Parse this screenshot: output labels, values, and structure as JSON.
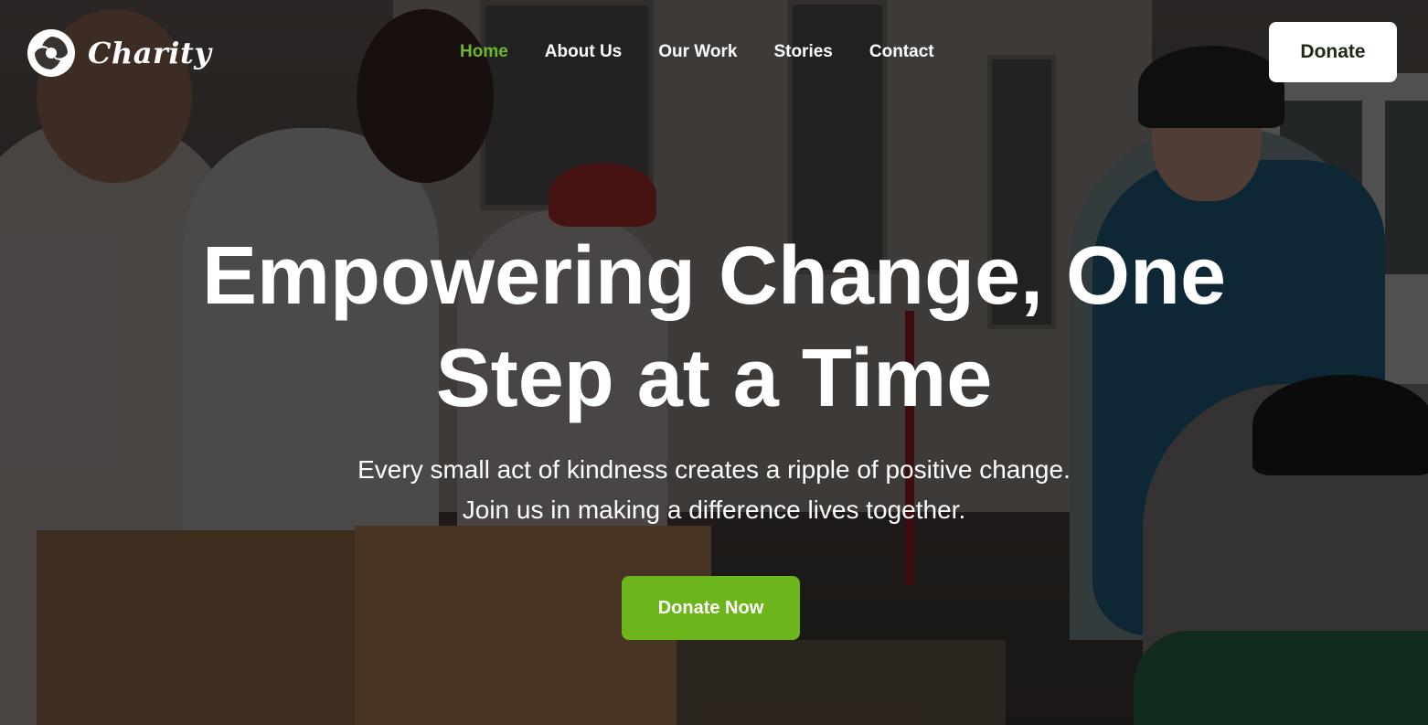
{
  "brand": {
    "name": "Charity",
    "logo_icon": "charity-swirl-logo-icon"
  },
  "nav": {
    "items": [
      {
        "label": "Home",
        "active": true
      },
      {
        "label": "About Us",
        "active": false
      },
      {
        "label": "Our Work",
        "active": false
      },
      {
        "label": "Stories",
        "active": false
      },
      {
        "label": "Contact",
        "active": false
      }
    ]
  },
  "header": {
    "donate_label": "Donate"
  },
  "hero": {
    "title_line1": "Empowering Change, One",
    "title_line2": "Step at a Time",
    "subtitle_line1": "Every small act of kindness creates a ripple of positive change.",
    "subtitle_line2": "Join us in making a difference lives together.",
    "cta_label": "Donate Now",
    "background": "volunteers-distributing-supplies-photo"
  },
  "colors": {
    "accent_green": "#6cb51b",
    "active_nav": "#6cb82a",
    "white": "#ffffff"
  }
}
